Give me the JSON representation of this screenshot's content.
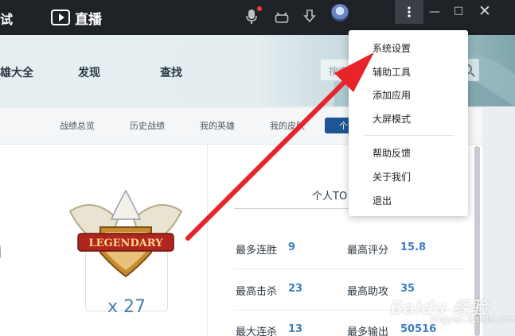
{
  "titlebar": {
    "left_fragment": "试",
    "live_label": "直播",
    "menu_icon": "more-vertical-icon",
    "minimize": "—",
    "maximize": "□",
    "close": "✕"
  },
  "nav": {
    "items": [
      "雄大全",
      "发现",
      "查找"
    ],
    "search_placeholder": "搜索"
  },
  "subtabs": {
    "items": [
      "战绩总览",
      "历史战绩",
      "我的英雄",
      "我的皮肤"
    ],
    "active": "个"
  },
  "medal": {
    "banner": "LEGENDARY",
    "count": "x 27"
  },
  "stats": {
    "title": "个人TO",
    "rows": [
      {
        "l_label": "最多连胜",
        "l_value": "9",
        "r_label": "最高评分",
        "r_value": "15.8"
      },
      {
        "l_label": "最高击杀",
        "l_value": "23",
        "r_label": "最高助攻",
        "r_value": "35"
      },
      {
        "l_label": "最大连杀",
        "l_value": "13",
        "r_label": "最多输出",
        "r_value": "50516"
      }
    ]
  },
  "menu": {
    "items": [
      "系统设置",
      "辅助工具",
      "添加应用",
      "大屏模式",
      "帮助反馈",
      "关于我们",
      "退出"
    ]
  },
  "watermark": {
    "brand": "Baidu 经验",
    "sub": "jingyan.baidu.com"
  },
  "colors": {
    "accent": "#1e5593",
    "value_blue": "#3c7fc0",
    "arrow_red": "#e8242b"
  }
}
